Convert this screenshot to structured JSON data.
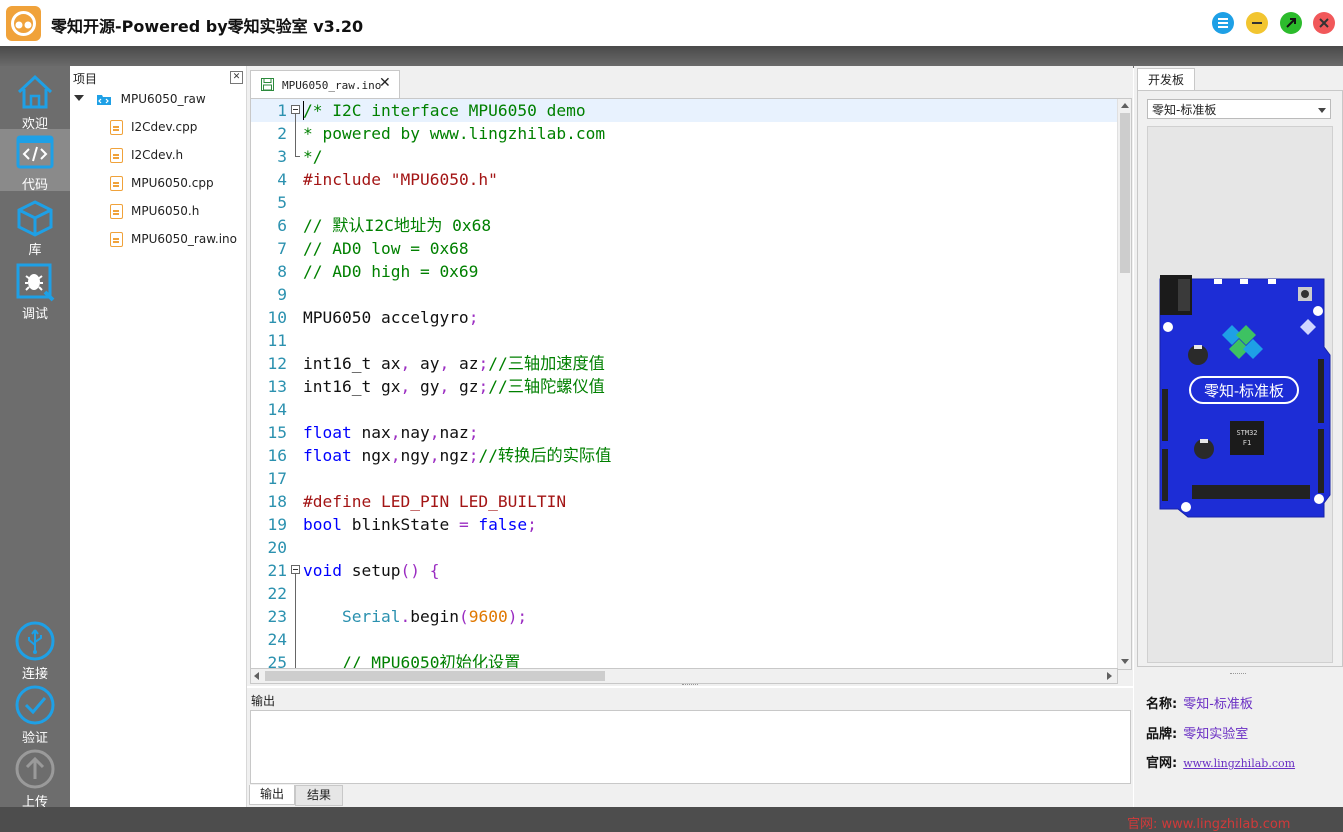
{
  "window": {
    "title": "零知开源-Powered by零知实验室 v3.20"
  },
  "nav": {
    "items": [
      {
        "label": "欢迎",
        "icon": "home-icon"
      },
      {
        "label": "代码",
        "icon": "code-icon"
      },
      {
        "label": "库",
        "icon": "library-box-icon"
      },
      {
        "label": "调试",
        "icon": "debug-bug-icon"
      }
    ],
    "bottom_items": [
      {
        "label": "连接",
        "icon": "usb-icon"
      },
      {
        "label": "验证",
        "icon": "check-icon"
      },
      {
        "label": "上传",
        "icon": "upload-arrow-icon"
      }
    ],
    "active_index": 1
  },
  "project": {
    "title": "项目",
    "root": "MPU6050_raw",
    "files": [
      "I2Cdev.cpp",
      "I2Cdev.h",
      "MPU6050.cpp",
      "MPU6050.h",
      "MPU6050_raw.ino"
    ]
  },
  "editor": {
    "tab_label": "MPU6050_raw.ino",
    "line_numbers": [
      "1",
      "2",
      "3",
      "4",
      "5",
      "6",
      "7",
      "8",
      "9",
      "10",
      "11",
      "12",
      "13",
      "14",
      "15",
      "16",
      "17",
      "18",
      "19",
      "20",
      "21",
      "22",
      "23",
      "24",
      "25"
    ],
    "lines": [
      [
        [
          "c-comment",
          "/* I2C interface MPU6050 demo"
        ]
      ],
      [
        [
          "c-comment",
          "* powered by www.lingzhilab.com"
        ]
      ],
      [
        [
          "c-comment",
          "*/"
        ]
      ],
      [
        [
          "c-pre",
          "#include "
        ],
        [
          "c-str",
          "\"MPU6050.h\""
        ]
      ],
      [],
      [
        [
          "c-comment",
          "// 默认I2C地址为 0x68"
        ]
      ],
      [
        [
          "c-comment",
          "// AD0 low = 0x68"
        ]
      ],
      [
        [
          "c-comment",
          "// AD0 high = 0x69"
        ]
      ],
      [],
      [
        [
          "",
          "MPU6050 accelgyro"
        ],
        [
          "c-punc",
          ";"
        ]
      ],
      [],
      [
        [
          "",
          "int16_t ax"
        ],
        [
          "c-punc",
          ","
        ],
        [
          "",
          " ay"
        ],
        [
          "c-punc",
          ","
        ],
        [
          "",
          " az"
        ],
        [
          "c-punc",
          ";"
        ],
        [
          "c-comment",
          "//三轴加速度值"
        ]
      ],
      [
        [
          "",
          "int16_t gx"
        ],
        [
          "c-punc",
          ","
        ],
        [
          "",
          " gy"
        ],
        [
          "c-punc",
          ","
        ],
        [
          "",
          " gz"
        ],
        [
          "c-punc",
          ";"
        ],
        [
          "c-comment",
          "//三轴陀螺仪值"
        ]
      ],
      [],
      [
        [
          "c-kw",
          "float"
        ],
        [
          "",
          " nax"
        ],
        [
          "c-punc",
          ","
        ],
        [
          "",
          "nay"
        ],
        [
          "c-punc",
          ","
        ],
        [
          "",
          "naz"
        ],
        [
          "c-punc",
          ";"
        ]
      ],
      [
        [
          "c-kw",
          "float"
        ],
        [
          "",
          " ngx"
        ],
        [
          "c-punc",
          ","
        ],
        [
          "",
          "ngy"
        ],
        [
          "c-punc",
          ","
        ],
        [
          "",
          "ngz"
        ],
        [
          "c-punc",
          ";"
        ],
        [
          "c-comment",
          "//转换后的实际值"
        ]
      ],
      [],
      [
        [
          "c-pre",
          "#define LED_PIN LED_BUILTIN"
        ]
      ],
      [
        [
          "c-kw",
          "bool"
        ],
        [
          "",
          " blinkState "
        ],
        [
          "c-punc",
          "="
        ],
        [
          "c-kw",
          " false"
        ],
        [
          "c-punc",
          ";"
        ]
      ],
      [],
      [
        [
          "c-kw",
          "void"
        ],
        [
          "",
          " setup"
        ],
        [
          "c-punc",
          "() {"
        ]
      ],
      [],
      [
        [
          "",
          "    "
        ],
        [
          "c-cls",
          "Serial"
        ],
        [
          "c-punc",
          "."
        ],
        [
          "",
          "begin"
        ],
        [
          "c-punc",
          "("
        ],
        [
          "c-num",
          "9600"
        ],
        [
          "c-punc",
          ");"
        ]
      ],
      [],
      [
        [
          "",
          "    "
        ],
        [
          "c-comment",
          "// MPU6050初始化设置"
        ]
      ]
    ]
  },
  "output": {
    "title": "输出",
    "tabs": [
      "输出",
      "结果"
    ]
  },
  "board": {
    "tab_label": "开发板",
    "selected_board": "零知-标准板",
    "image_labels": {
      "title": "零知-标准板",
      "chip_line1": "STM32",
      "chip_line2": "F1"
    },
    "info": {
      "name_label": "名称:",
      "name_value": "零知-标准板",
      "brand_label": "品牌:",
      "brand_value": "零知实验室",
      "site_label": "官网:",
      "site_value": "www.lingzhilab.com"
    }
  },
  "status": {
    "text": "官网: www.lingzhilab.com"
  },
  "colors": {
    "nav_bg": "#6d6d6d",
    "accent_blue": "#1ea0e6",
    "logo_orange": "#f0a23a",
    "link_purple": "#6a2fc4"
  }
}
